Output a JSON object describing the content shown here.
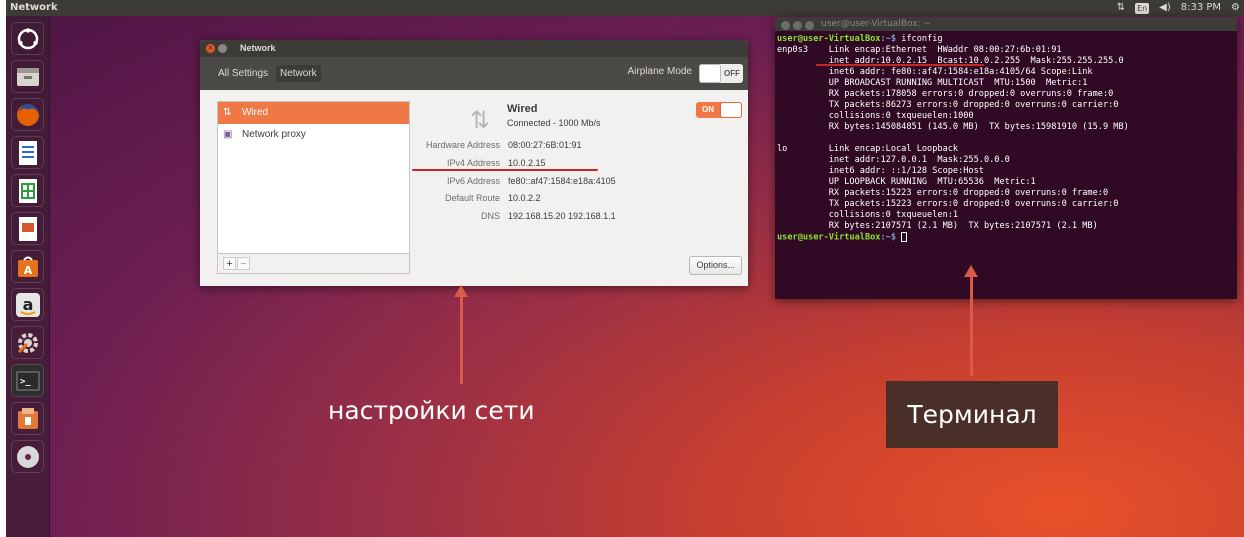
{
  "topbar": {
    "title": "Network",
    "keyboard_layout": "En",
    "time": "8:33 PM"
  },
  "launcher": {
    "items": [
      {
        "icon": "ubuntu-dash-icon",
        "color": "#5a2c4e"
      },
      {
        "icon": "files-icon",
        "color": "#8a8580"
      },
      {
        "icon": "firefox-icon",
        "color": "#e66000"
      },
      {
        "icon": "libreoffice-writer-icon",
        "color": "#2a6ebb"
      },
      {
        "icon": "libreoffice-calc-icon",
        "color": "#2e9e3a"
      },
      {
        "icon": "libreoffice-impress-icon",
        "color": "#d4582a"
      },
      {
        "icon": "software-center-icon",
        "color": "#e5731e"
      },
      {
        "icon": "amazon-icon",
        "color": "#e6e6e6"
      },
      {
        "icon": "system-settings-icon",
        "color": "#5e5c5a"
      },
      {
        "icon": "terminal-icon",
        "color": "#2f2f2f"
      },
      {
        "icon": "file-archive-icon",
        "color": "#e07a3a"
      },
      {
        "icon": "dvd-icon",
        "color": "#d8d8d8"
      }
    ],
    "amazon_glyph": "a",
    "amazon_color": "#222222"
  },
  "network_window": {
    "title": "Network",
    "breadcrumb_all": "All Settings",
    "breadcrumb_current": "Network",
    "airplane_label": "Airplane Mode",
    "airplane_state": "OFF",
    "sidebar": [
      {
        "label": "Wired",
        "selected": true
      },
      {
        "label": "Network proxy",
        "selected": false
      }
    ],
    "add_label": "+",
    "remove_label": "−",
    "connection_title": "Wired",
    "connection_status": "Connected - 1000 Mb/s",
    "switch_state": "ON",
    "details": [
      {
        "label": "Hardware Address",
        "value": "08:00:27:6B:01:91"
      },
      {
        "label": "IPv4 Address",
        "value": "10.0.2.15"
      },
      {
        "label": "IPv6 Address",
        "value": "fe80::af47:1584:e18a:4105"
      },
      {
        "label": "Default Route",
        "value": "10.0.2.2"
      },
      {
        "label": "DNS",
        "value": "192.168.15.20 192.168.1.1"
      }
    ],
    "options_label": "Options..."
  },
  "terminal": {
    "title": "user@user-VirtualBox: ~",
    "prompt_user": "user@user-VirtualBox",
    "prompt_path": ":~$",
    "command": " ifconfig",
    "output": "enp0s3    Link encap:Ethernet  HWaddr 08:00:27:6b:01:91\n          inet addr:10.0.2.15  Bcast:10.0.2.255  Mask:255.255.255.0\n          inet6 addr: fe80::af47:1584:e18a:4105/64 Scope:Link\n          UP BROADCAST RUNNING MULTICAST  MTU:1500  Metric:1\n          RX packets:178058 errors:0 dropped:0 overruns:0 frame:0\n          TX packets:86273 errors:0 dropped:0 overruns:0 carrier:0\n          collisions:0 txqueuelen:1000\n          RX bytes:145084851 (145.0 MB)  TX bytes:15981910 (15.9 MB)\n\nlo        Link encap:Local Loopback\n          inet addr:127.0.0.1  Mask:255.0.0.0\n          inet6 addr: ::1/128 Scope:Host\n          UP LOOPBACK RUNNING  MTU:65536  Metric:1\n          RX packets:15223 errors:0 dropped:0 overruns:0 frame:0\n          TX packets:15223 errors:0 dropped:0 overruns:0 carrier:0\n          collisions:0 txqueuelen:1\n          RX bytes:2107571 (2.1 MB)  TX bytes:2107571 (2.1 MB)\n"
  },
  "annotations": {
    "network_caption": "настройки сети",
    "terminal_caption": "Терминал",
    "arrow_color": "#d95a4a",
    "underline_color": "#c62828"
  }
}
